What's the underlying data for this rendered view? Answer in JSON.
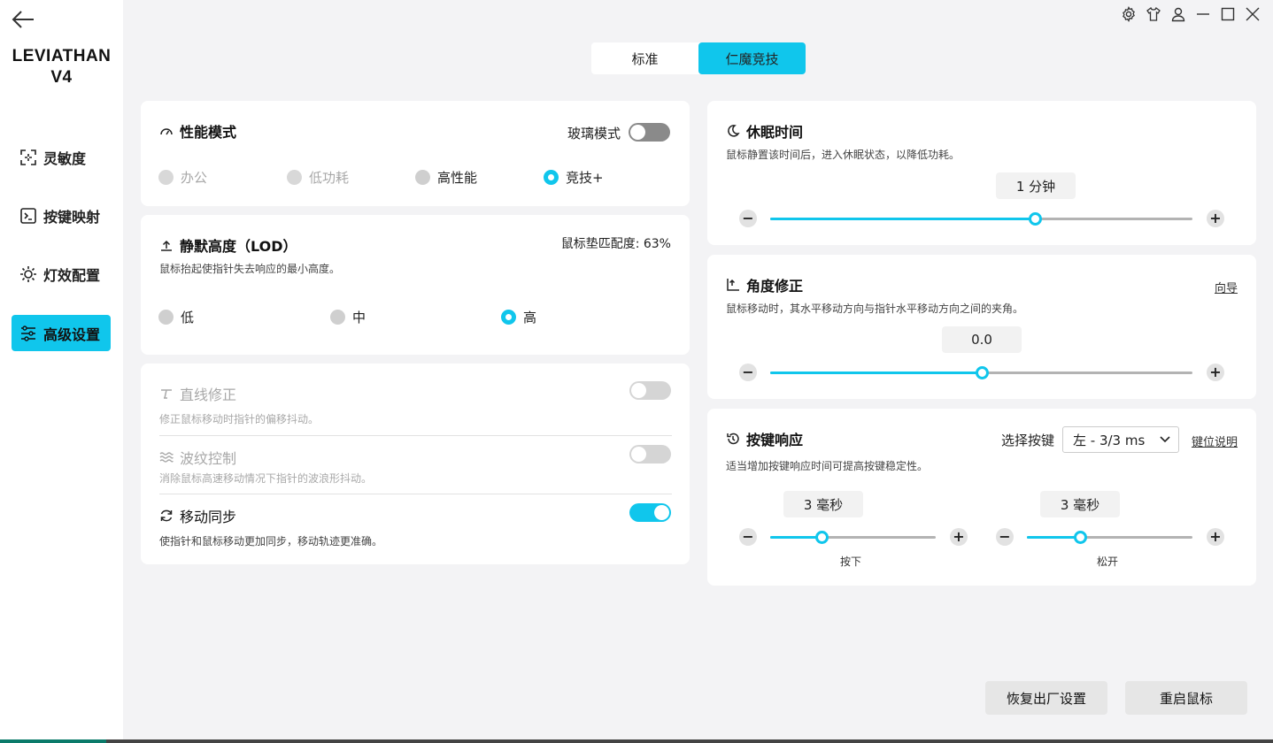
{
  "app": {
    "product_line1": "LEVIATHAN",
    "product_line2": "V4"
  },
  "nav": [
    {
      "label": "灵敏度",
      "icon": "sensitivity-icon"
    },
    {
      "label": "按键映射",
      "icon": "keymap-icon"
    },
    {
      "label": "灯效配置",
      "icon": "light-icon"
    },
    {
      "label": "高级设置",
      "icon": "settings-sliders-icon",
      "active": true
    }
  ],
  "mode_tabs": [
    {
      "label": "标准"
    },
    {
      "label": "仁魔竞技",
      "active": true
    }
  ],
  "performance": {
    "title": "性能模式",
    "glass_label": "玻璃模式",
    "glass_on": false,
    "options": [
      "办公",
      "低功耗",
      "高性能",
      "竞技+"
    ],
    "selected": "竞技+"
  },
  "lod": {
    "title": "静默高度（LOD）",
    "match_text": "鼠标垫匹配度: 63%",
    "desc": "鼠标抬起使指针失去响应的最小高度。",
    "options": [
      "低",
      "中",
      "高"
    ],
    "selected": "高"
  },
  "straight": {
    "title": "直线修正",
    "desc": "修正鼠标移动时指针的偏移抖动。",
    "enabled": false
  },
  "ripple": {
    "title": "波纹控制",
    "desc": "消除鼠标高速移动情况下指针的波浪形抖动。",
    "enabled": false
  },
  "motion_sync": {
    "title": "移动同步",
    "desc": "使指针和鼠标移动更加同步，移动轨迹更准确。",
    "enabled": true
  },
  "sleep": {
    "title": "休眠时间",
    "desc": "鼠标静置该时间后，进入休眠状态，以降低功耗。",
    "value_text": "1 分钟",
    "level": 0.627
  },
  "angle": {
    "title": "角度修正",
    "guide": "向导",
    "desc": "鼠标移动时，其水平移动方向与指针水平移动方向之间的夹角。",
    "value_text": "0.0",
    "level": 0.5
  },
  "response": {
    "title": "按键响应",
    "select_label": "选择按键",
    "select_value": "左 - 3/3 ms",
    "key_desc_link": "键位说明",
    "desc": "适当增加按键响应时间可提高按键稳定性。",
    "press": {
      "value_text": "3 毫秒",
      "label": "按下",
      "level": 0.31
    },
    "release": {
      "value_text": "3 毫秒",
      "label": "松开",
      "level": 0.32
    }
  },
  "footer": {
    "reset": "恢复出厂设置",
    "restart": "重启鼠标"
  },
  "colors": {
    "accent": "#10c6ec",
    "background": "#f3f3f5",
    "card": "#ffffff"
  }
}
